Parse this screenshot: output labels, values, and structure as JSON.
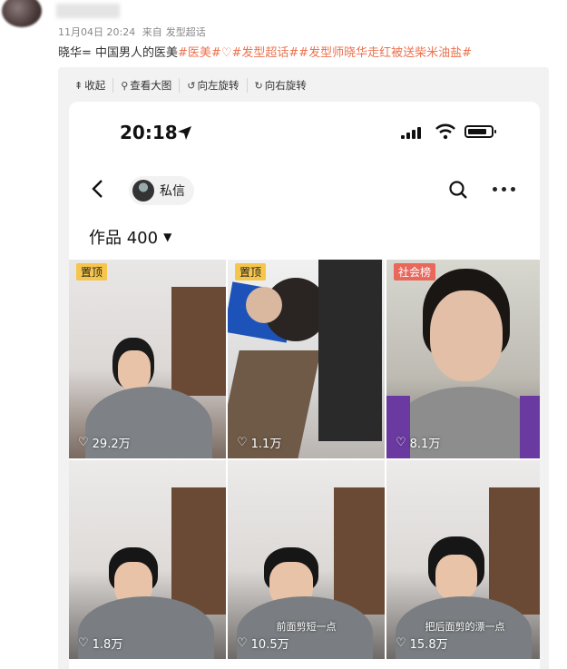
{
  "post": {
    "date": "11月04日 20:24",
    "source_prefix": "来自",
    "source": "发型超话",
    "text_main": "晓华= 中国男人的医美",
    "tags": [
      "#医美#",
      "#发型超话#",
      "#发型师晓华走红被送柴米油盐#"
    ],
    "tag_icon": "heart-diamond-icon"
  },
  "toolbar": {
    "collapse": "收起",
    "view_large": "查看大图",
    "rotate_left": "向左旋转",
    "rotate_right": "向右旋转"
  },
  "phone": {
    "time": "20:18",
    "dm_label": "私信",
    "works_label": "作品 400"
  },
  "grid": [
    {
      "badge": "置顶",
      "likes": "29.2万",
      "caption": ""
    },
    {
      "badge": "置顶",
      "likes": "1.1万",
      "caption": ""
    },
    {
      "badge": "社会榜",
      "likes": "8.1万",
      "caption": ""
    },
    {
      "badge": "",
      "likes": "1.8万",
      "caption": ""
    },
    {
      "badge": "",
      "likes": "10.5万",
      "caption": "前面剪短一点"
    },
    {
      "badge": "",
      "likes": "15.8万",
      "caption": "把后面剪的漂一点"
    }
  ],
  "colors": {
    "tag": "#eb7350",
    "pin_badge": "#f6c54b",
    "hot_badge": "#e9675b",
    "panel": "#f2f2f2"
  }
}
